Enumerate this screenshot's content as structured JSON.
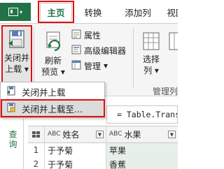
{
  "tabs": {
    "file_caret": "▾",
    "home": "主页",
    "transform": "转换",
    "add_column": "添加列",
    "view": "视图"
  },
  "ribbon": {
    "close_load_line1": "关闭并",
    "close_load_line2": "上载",
    "close_load_caret": "▾",
    "refresh_line1": "刷新",
    "refresh_line2": "预览",
    "properties": "属性",
    "advanced_editor": "高级编辑器",
    "manage": "管理",
    "select_line1": "选择",
    "select_line2": "列",
    "group_label": "管理列"
  },
  "dropdown": {
    "item1": "关闭并上载",
    "item2": "关闭并上载至..."
  },
  "formula_bar": {
    "text": "= Table.Trans"
  },
  "queries_pane": {
    "label": "查询"
  },
  "grid": {
    "headers": [
      "姓名",
      "水果"
    ],
    "type_badge": "ABC",
    "rows": [
      {
        "index": "1",
        "name": "于予菊",
        "fruit": "苹果"
      },
      {
        "index": "2",
        "name": "于予菊",
        "fruit": "香蕉"
      }
    ]
  },
  "colors": {
    "accent": "#217346",
    "highlight_border": "#e01010"
  }
}
